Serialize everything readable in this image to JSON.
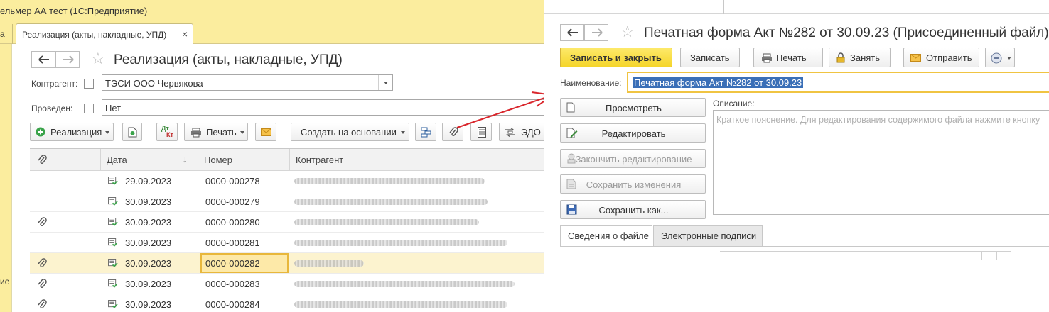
{
  "left": {
    "app_title": "ельмер АА тест  (1С:Предприятие)",
    "tabs": {
      "stub_label": "а",
      "active_label": "Реализация (акты, накладные, УПД)",
      "close_glyph": "×"
    },
    "side_label": "ие",
    "title": "Реализация (акты, накладные, УПД)",
    "filters": {
      "counterparty_label": "Контрагент:",
      "counterparty_value": "ТЭСИ ООО Червякова",
      "posted_label": "Проведен:",
      "posted_value": "Нет"
    },
    "toolbar": {
      "sales_label": "Реализация",
      "dt_kt_top": "Дт",
      "dt_kt_bottom": "Кт",
      "print_label": "Печать",
      "create_based_label": "Создать на основании",
      "edo_label": "ЭДО"
    },
    "table": {
      "columns": [
        "",
        "Дата",
        "Номер",
        "Контрагент"
      ],
      "sort_indicator": "↓",
      "rows": [
        {
          "attach": false,
          "date": "29.09.2023",
          "number": "0000-000278",
          "selected": false
        },
        {
          "attach": false,
          "date": "30.09.2023",
          "number": "0000-000279",
          "selected": false
        },
        {
          "attach": true,
          "date": "30.09.2023",
          "number": "0000-000280",
          "selected": false
        },
        {
          "attach": false,
          "date": "30.09.2023",
          "number": "0000-000281",
          "selected": false
        },
        {
          "attach": true,
          "date": "30.09.2023",
          "number": "0000-000282",
          "selected": true
        },
        {
          "attach": true,
          "date": "30.09.2023",
          "number": "0000-000283",
          "selected": false
        },
        {
          "attach": true,
          "date": "30.09.2023",
          "number": "0000-000284",
          "selected": false
        }
      ]
    }
  },
  "right": {
    "title": "Печатная форма Акт №282 от 30.09.23 (Присоединенный файл)",
    "toolbar": {
      "save_close": "Записать и закрыть",
      "save": "Записать",
      "print": "Печать",
      "lock": "Занять",
      "send": "Отправить"
    },
    "name_label": "Наименование:",
    "name_value": "Печатная форма Акт №282 от 30.09.23",
    "description_label": "Описание:",
    "description_placeholder": "Краткое пояснение. Для редактирования содержимого файла нажмите кнопку",
    "side_buttons": {
      "view": "Просмотреть",
      "edit": "Редактировать",
      "finish_edit": "Закончить редактирование",
      "save_changes": "Сохранить изменения",
      "save_as": "Сохранить как..."
    },
    "tabs": {
      "file_info": "Сведения о файле",
      "signatures": "Электронные подписи"
    }
  },
  "colors": {
    "title_bar": "#fbed9e",
    "accent_yellow": "#f5d52a",
    "selection_fill": "#fde9a8",
    "arrow_red": "#d9262c",
    "text_selection": "#3a6fb7"
  }
}
